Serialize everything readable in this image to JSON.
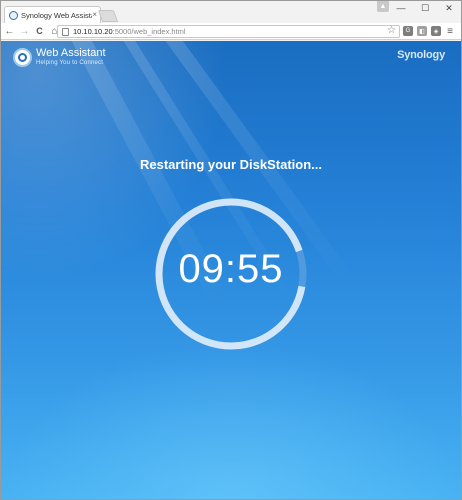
{
  "browser": {
    "tab_title": "Synology Web Assistant",
    "tab_close": "×",
    "profile_glyph": "▲",
    "window_controls": [
      "—",
      "☐",
      "✕"
    ],
    "nav": {
      "back": "←",
      "forward": "→",
      "reload": "C",
      "home": "⌂"
    },
    "url_host": "10.10.10.20",
    "url_rest": ":5000/web_index.html",
    "bookmark_glyph": "☆",
    "extensions": [
      "G",
      "◧",
      "◈"
    ],
    "menu_glyph": "≡"
  },
  "page": {
    "brand_title": "Web Assistant",
    "brand_subtitle": "Helping You to Connect",
    "vendor_logo_text": "Synology",
    "status_message": "Restarting your DiskStation...",
    "countdown": "09:55",
    "countdown_progress": 0.92
  },
  "colors": {
    "background_top": "#1a6dc1",
    "background_bottom": "#48b3f3",
    "ring_track": "#6fa8e0",
    "ring_progress": "#e8f2fc"
  }
}
